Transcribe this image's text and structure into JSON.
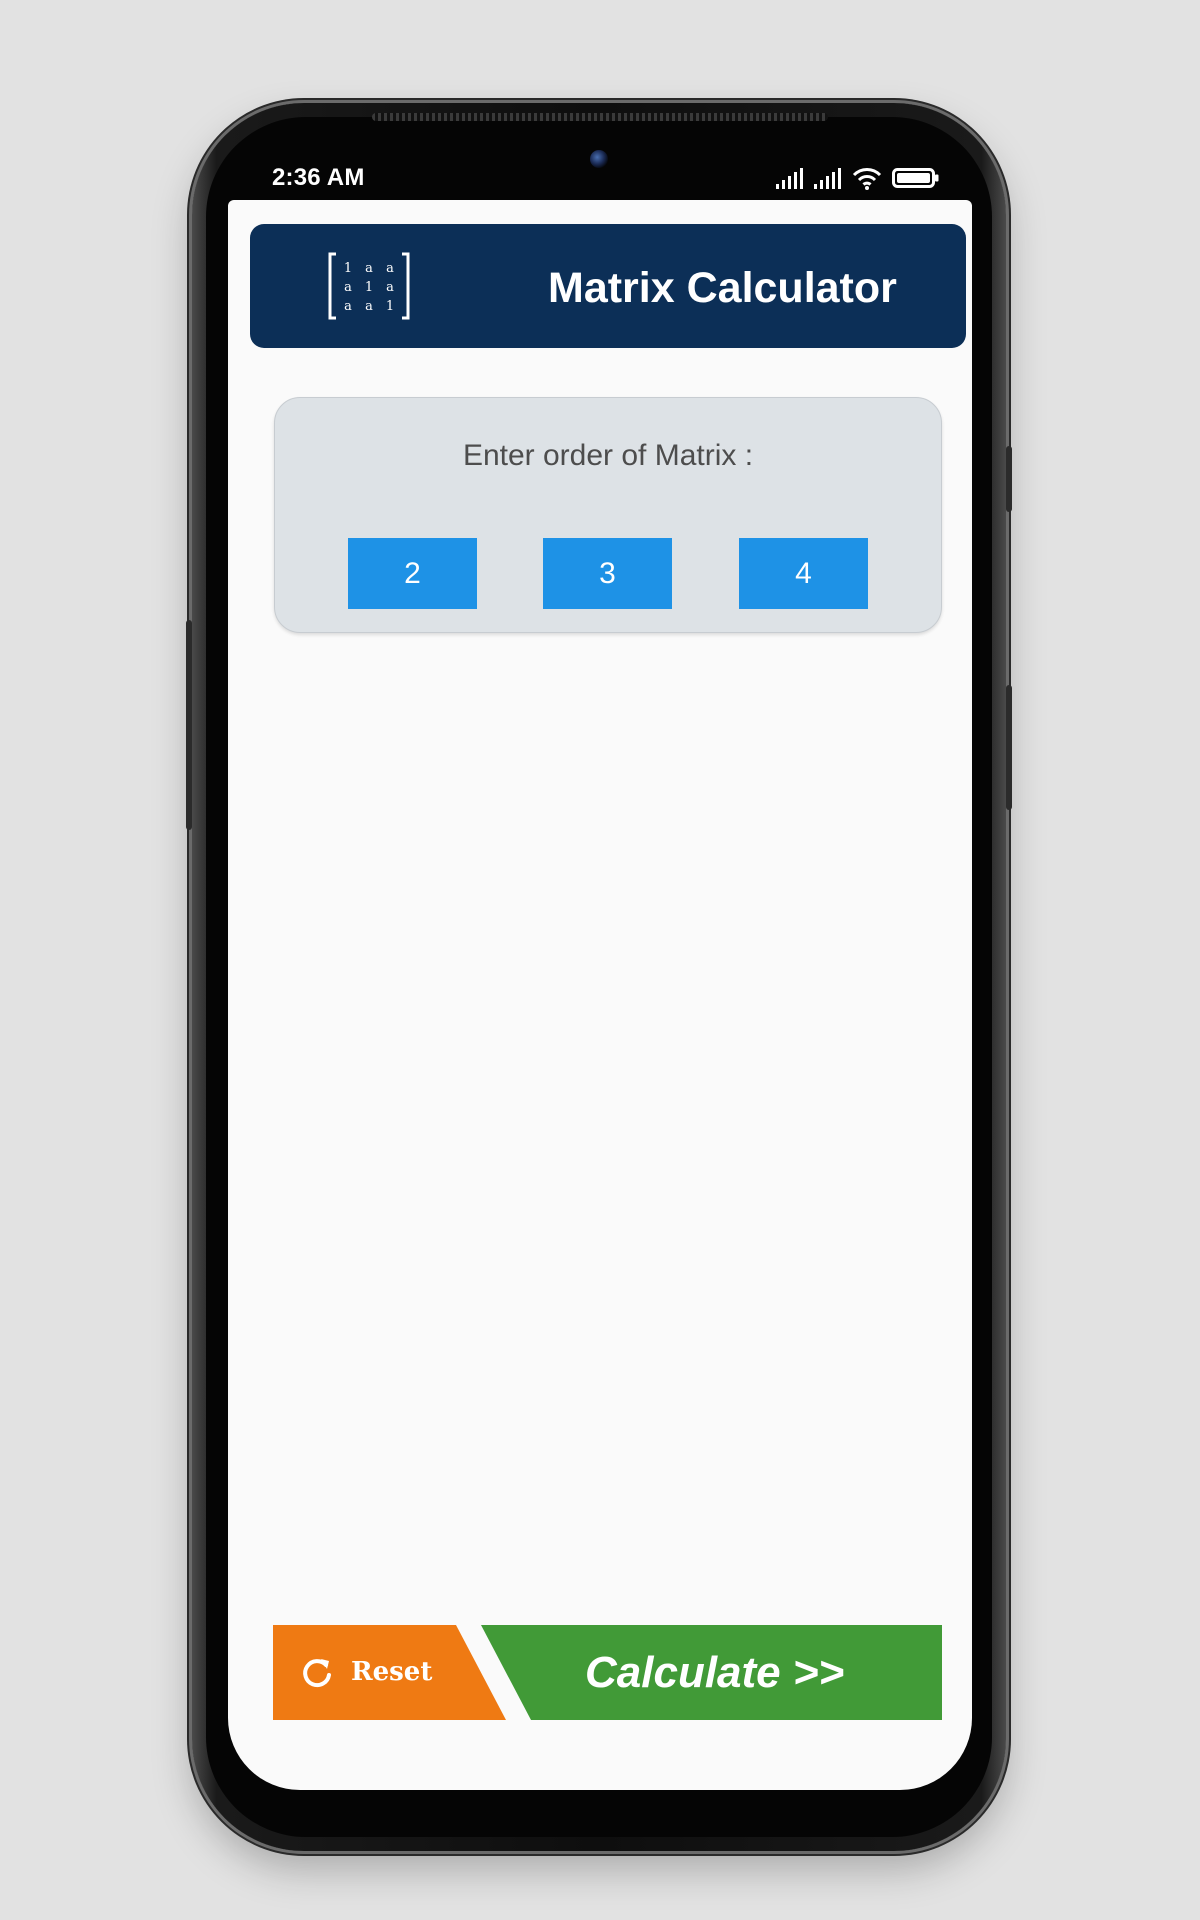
{
  "status_bar": {
    "time": "2:36 AM",
    "icons": [
      "signal-icon",
      "signal-icon",
      "wifi-icon",
      "battery-icon"
    ]
  },
  "header": {
    "title": "Matrix Calculator",
    "logo_icon": "matrix-icon",
    "logo_cells": [
      "1",
      "a",
      "a",
      "a",
      "1",
      "a",
      "a",
      "a",
      "1"
    ]
  },
  "order": {
    "prompt": "Enter order of Matrix :",
    "options": [
      "2",
      "3",
      "4"
    ]
  },
  "actions": {
    "reset_label": "Reset",
    "reset_icon": "refresh-icon",
    "calculate_label": "Calculate  >>"
  },
  "colors": {
    "header_bg": "#0c2f57",
    "order_button": "#1e92e6",
    "reset_button": "#ef7a13",
    "calculate_button": "#419a37"
  }
}
